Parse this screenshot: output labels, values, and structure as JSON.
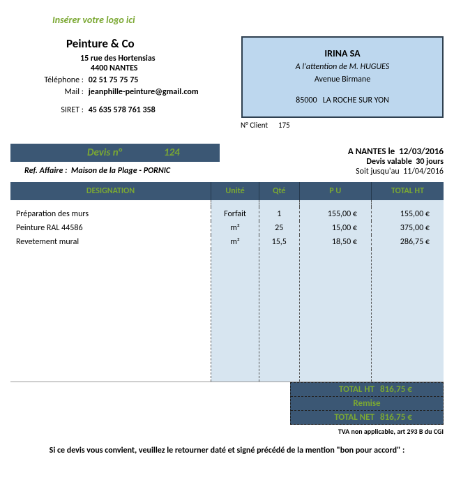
{
  "logo_placeholder": "Insérer votre logo ici",
  "company": {
    "name": "Peinture & Co",
    "addr1": "15 rue des Hortensias",
    "addr2": "4400 NANTES",
    "phone_label": "Téléphone :",
    "phone": "02 51 75 75 75",
    "mail_label": "Mail :",
    "mail": "jeanphille-peinture@gmail.com",
    "siret_label": "SIRET :",
    "siret": "45 635 578 761 358"
  },
  "client": {
    "name": "IRINA SA",
    "attention": "A l'attention de M. HUGUES",
    "street": "Avenue Birmane",
    "postal": "85000",
    "city": "LA ROCHE SUR YON",
    "no_label": "N° Client",
    "no": "175"
  },
  "devis": {
    "num_label": "Devis n°",
    "num": "124",
    "ref_label": "Ref. Affaire :",
    "ref": "Maison de la Plage - PORNIC",
    "place_label": "A NANTES le",
    "date": "12/03/2016",
    "valid_label": "Devis valable",
    "valid_value": "30 jours",
    "until_label": "Soit jusqu'au",
    "until_value": "11/04/2016"
  },
  "columns": {
    "designation": "DESIGNATION",
    "unit": "Unité",
    "qty": "Qté",
    "pu": "P U",
    "total": "TOTAL HT"
  },
  "lines": [
    {
      "desc": "Préparation des murs",
      "unit": "Forfait",
      "qty": "1",
      "pu": "155,00 €",
      "total": "155,00 €"
    },
    {
      "desc": "Peinture RAL 44586",
      "unit": "m²",
      "qty": "25",
      "pu": "15,00 €",
      "total": "375,00 €"
    },
    {
      "desc": "Revetement mural",
      "unit": "m²",
      "qty": "15,5",
      "pu": "18,50 €",
      "total": "286,75 €"
    }
  ],
  "totals": {
    "ht_label": "TOTAL HT",
    "ht_value": "816,75 €",
    "remise_label": "Remise",
    "remise_value": "",
    "net_label": "TOTAL NET",
    "net_value": "816,75 €"
  },
  "tva_note": "TVA non applicable, art 293 B du CGI",
  "footer": "Si ce devis vous convient, veuillez le retourner daté et signé précédé de la mention \"bon pour accord\" :"
}
